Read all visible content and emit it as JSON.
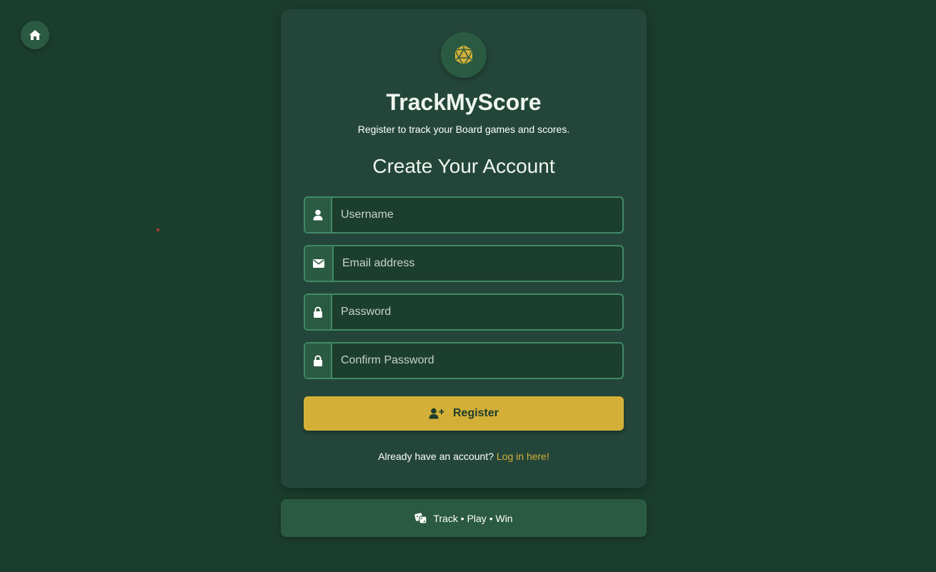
{
  "nav": {
    "home_icon": "home-icon"
  },
  "brand": {
    "logo_icon": "d20-dice-icon",
    "title": "TrackMyScore",
    "subtitle": "Register to track your Board games and scores."
  },
  "form": {
    "heading": "Create Your Account",
    "username": {
      "placeholder": "Username",
      "value": "",
      "icon": "user-icon"
    },
    "email": {
      "placeholder": "Email address",
      "value": "",
      "icon": "envelope-icon"
    },
    "password": {
      "placeholder": "Password",
      "value": "",
      "icon": "lock-icon"
    },
    "confirm_password": {
      "placeholder": "Confirm Password",
      "value": "",
      "icon": "lock-icon"
    },
    "register_label": "Register",
    "register_icon": "user-plus-icon"
  },
  "login": {
    "prompt": "Already have an account?",
    "link_label": "Log in here!"
  },
  "footer": {
    "icon": "dice-icon",
    "text": "Track • Play • Win"
  },
  "colors": {
    "background": "#1b3d2d",
    "card": "#24463a",
    "accent": "#d4af37",
    "field_border": "#3e8a68"
  }
}
